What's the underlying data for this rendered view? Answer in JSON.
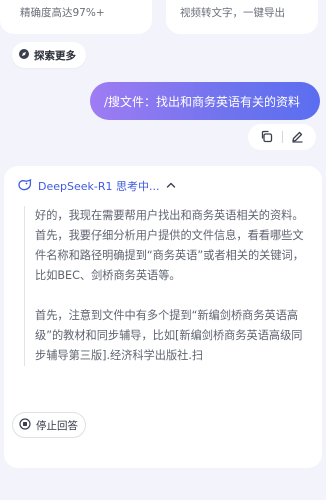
{
  "feature_cards": {
    "left_text": "精确度高达97%+",
    "right_text": "视频转文字，一键导出"
  },
  "explore_button": {
    "label": "探索更多",
    "icon": "explore-icon"
  },
  "user_message": {
    "text": "/搜文件：找出和商务英语有关的资料"
  },
  "message_actions": {
    "copy_icon": "copy-icon",
    "edit_icon": "edit-icon"
  },
  "thinking": {
    "title": "DeepSeek-R1 思考中...",
    "paragraphs": [
      "好的，我现在需要帮用户找出和商务英语相关的资料。首先，我要仔细分析用户提供的文件信息，看看哪些文件名称和路径明确提到“商务英语”或者相关的关键词，比如BEC、剑桥商务英语等。",
      "首先，注意到文件中有多个提到“新编剑桥商务英语高级”的教材和同步辅导，比如[新编剑桥商务英语高级同步辅导第三版].经济科学出版社.扫"
    ]
  },
  "stop_button": {
    "label": "停止回答",
    "icon": "stop-icon"
  },
  "colors": {
    "accent": "#3d5ae0",
    "bubble_start": "#9f7cf3",
    "bubble_end": "#5b6ef0",
    "background": "#f3f4fb"
  }
}
